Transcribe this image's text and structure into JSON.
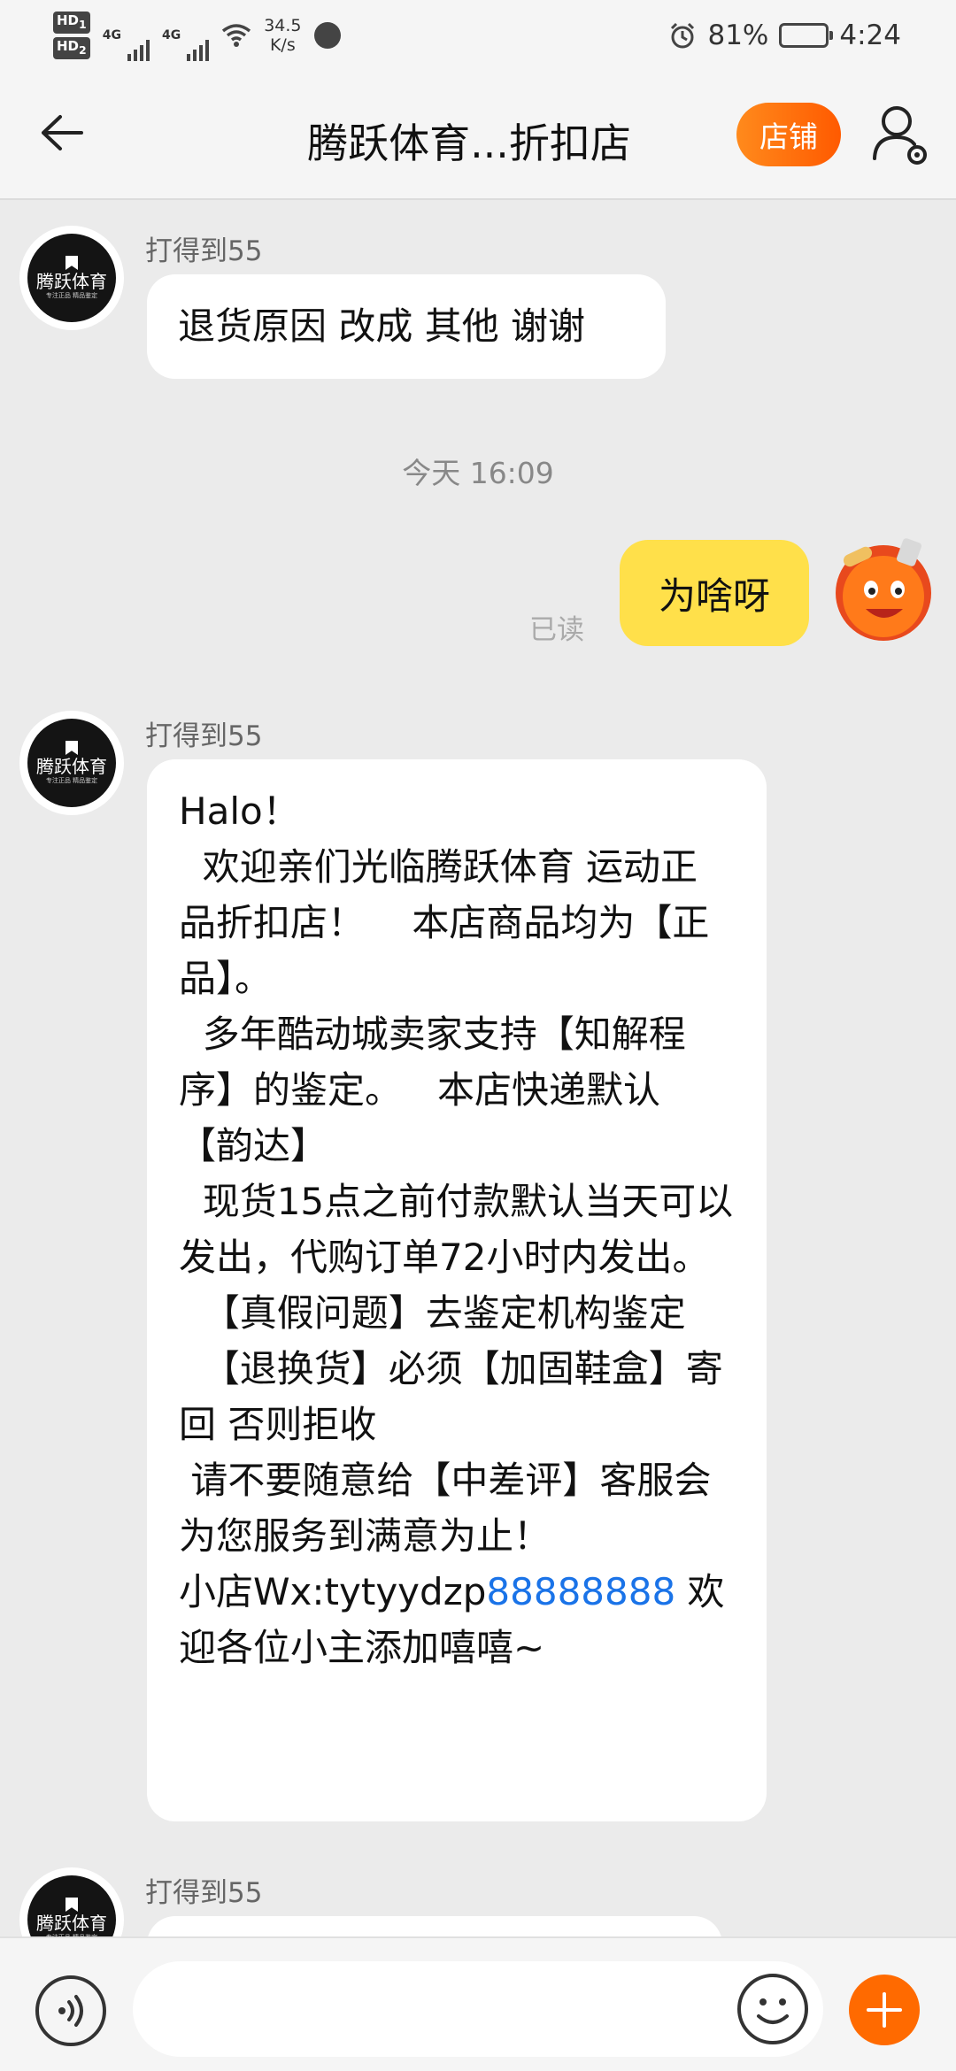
{
  "status_bar": {
    "hd1": "HD",
    "hd1_sub": "1",
    "hd2": "HD",
    "hd2_sub": "2",
    "net1": "4G",
    "net2": "4G",
    "speed_value": "34.5",
    "speed_unit": "K/s",
    "battery": "81%",
    "battery_level": 0.81,
    "time": "4:24"
  },
  "nav": {
    "title": "腾跃体育...折扣店",
    "shop_label": "店铺"
  },
  "avatar_brand": "腾跃体育",
  "avatar_tagline": "专注正品 精品鉴定",
  "messages": {
    "m1": {
      "sender": "打得到55",
      "text": "退货原因 改成 其他 谢谢"
    },
    "timestamp": "今天  16:09",
    "m2": {
      "text": "为啥呀",
      "status": "已读"
    },
    "m3": {
      "sender": "打得到55",
      "body": "Halo！\n  欢迎亲们光临腾跃体育 运动正品折扣店！    本店商品均为【正品】。\n  多年酷动城卖家支持【知解程序】的鉴定。   本店快递默认【韵达】\n  现货15点之前付款默认当天可以发出，代购订单72小时内发出。\n  【真假问题】去鉴定机构鉴定\n  【退换货】必须【加固鞋盒】寄回 否则拒收\n 请不要随意给【中差评】客服会为您服务到满意为止！\n小店Wx:tytyydzp",
      "link": "88888888",
      "tail": " 欢迎各位小主添加嘻嘻~"
    },
    "m4": {
      "sender": "打得到55"
    }
  },
  "input": {
    "placeholder": ""
  },
  "colors": {
    "accent": "#ff6a00",
    "bubble_out": "#ffe04a",
    "link": "#1a73e8"
  }
}
